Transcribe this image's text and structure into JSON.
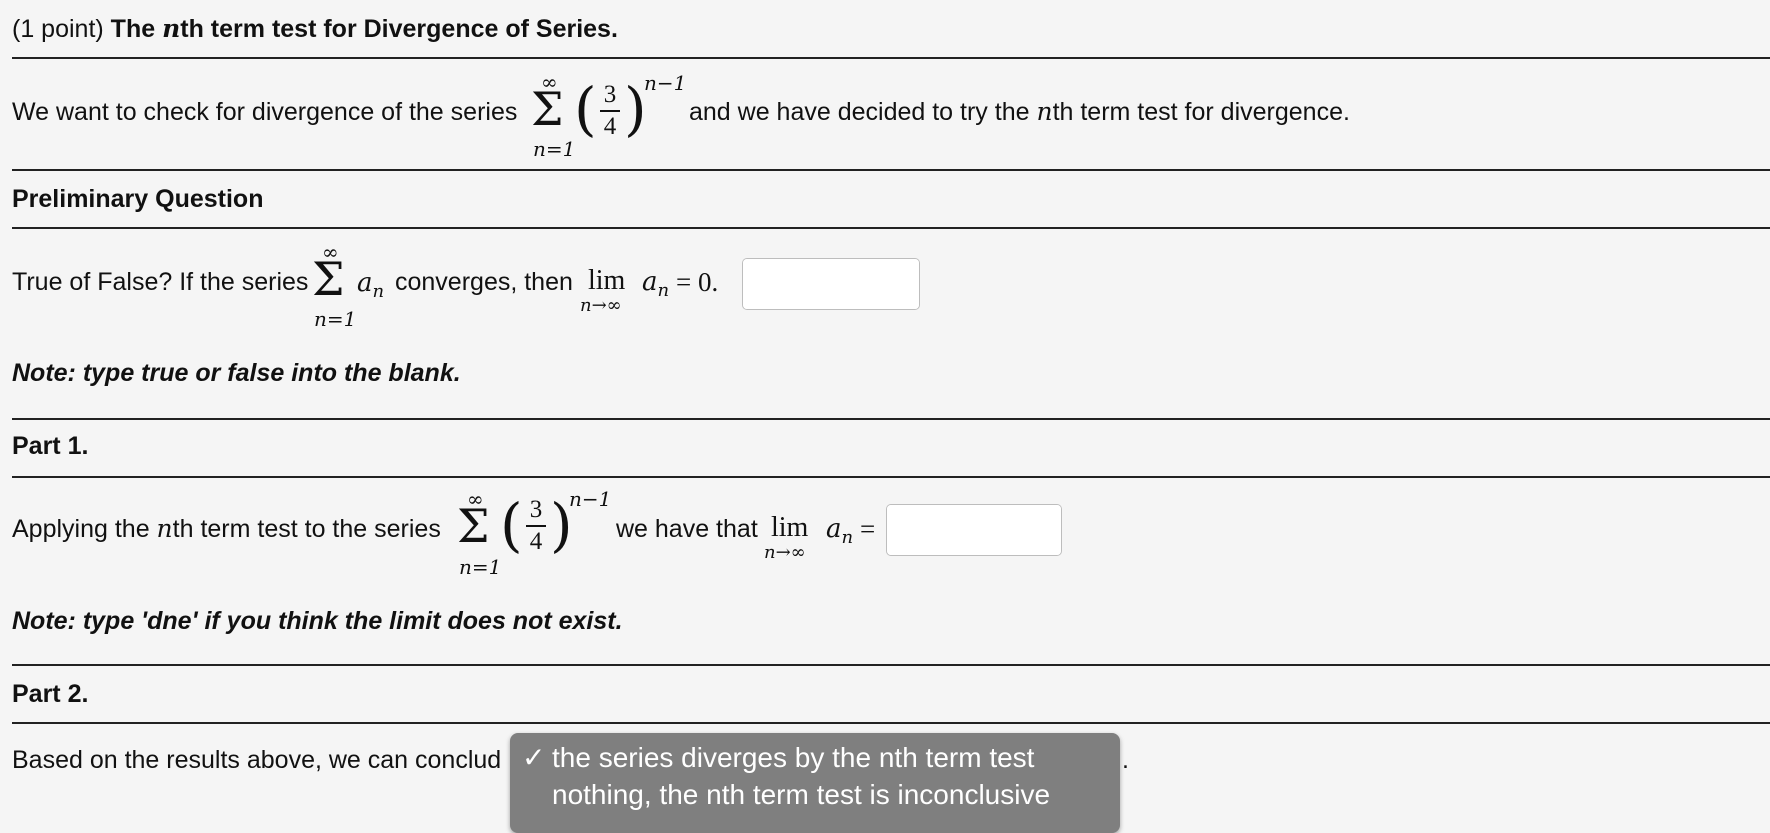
{
  "title": {
    "points": "(1 point)",
    "prefix": "The ",
    "n": "n",
    "suffix": "th term test for Divergence of Series."
  },
  "intro": {
    "before": "We want to check for divergence of the series",
    "after": "and we have decided to try the ",
    "n": "n",
    "after2": "th term test for divergence.",
    "series": {
      "upper": "∞",
      "lower": "n=1",
      "numerator": "3",
      "denominator": "4",
      "exponent": "n−1"
    }
  },
  "preliminary": {
    "heading": "Preliminary Question",
    "q_prefix": "True of False? If the series",
    "series_upper": "∞",
    "series_lower": "n=1",
    "term": "a",
    "term_sub": "n",
    "mid": "converges, then",
    "lim": "lim",
    "lim_sub": "n→∞",
    "tail_a": "a",
    "tail_sub": "n",
    "equals": "= 0.",
    "answer_value": "",
    "note": "Note: type true or false into the blank."
  },
  "part1": {
    "heading": "Part 1.",
    "prefix": "Applying the ",
    "n": "n",
    "prefix2": "th term test to the series",
    "series": {
      "upper": "∞",
      "lower": "n=1",
      "numerator": "3",
      "denominator": "4",
      "exponent": "n−1"
    },
    "mid": "we have that",
    "lim": "lim",
    "lim_sub": "n→∞",
    "tail_a": "a",
    "tail_sub": "n",
    "equals": "=",
    "answer_value": "",
    "note": "Note: type 'dne' if you think the limit does not exist."
  },
  "part2": {
    "heading": "Part 2.",
    "prefix": "Based on the results above, we can conclud",
    "period": ".",
    "dropdown": {
      "options": [
        {
          "label": "the series diverges by the nth term test",
          "checked": true
        },
        {
          "label": "nothing, the nth term test is inconclusive",
          "checked": false
        }
      ],
      "check_mark": "✓"
    }
  },
  "icons": {
    "palette": "grid-icon"
  },
  "colors": {
    "background": "#f5f5f5",
    "dropdown": "#7f7f7f"
  }
}
